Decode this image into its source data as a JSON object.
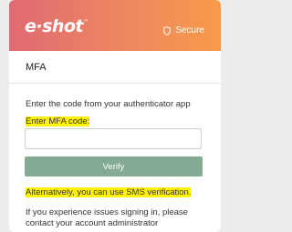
{
  "header": {
    "logo_text": "e·shot",
    "logo_mark": "™",
    "secure_label": "Secure",
    "secure_icon": "shield-icon"
  },
  "page_title": "MFA",
  "instructions": "Enter the code from your authenticator app",
  "mfa_label": "Enter MFA code:",
  "mfa_input": {
    "value": "",
    "placeholder": ""
  },
  "verify_button": "Verify",
  "sms": {
    "prefix": "Alternatively, you can ",
    "link": "use SMS verification."
  },
  "help": {
    "line1": "If you experience issues signing in, please",
    "line2": "contact your account administrator"
  },
  "colors": {
    "header_start": "#e06a73",
    "header_end": "#f79a4a",
    "button": "#83aa92",
    "highlight": "#fff200"
  }
}
